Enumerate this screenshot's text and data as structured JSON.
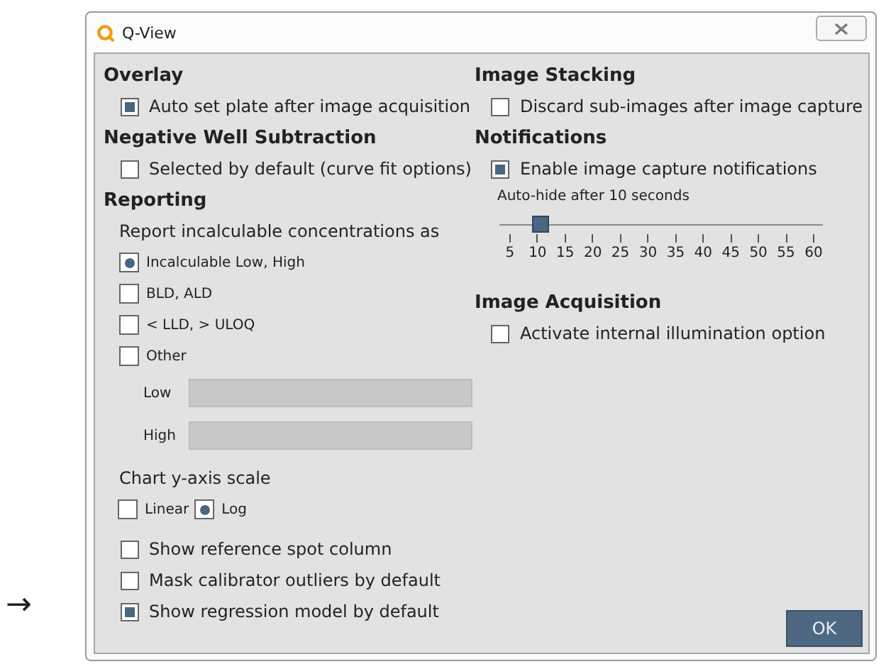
{
  "side_arrow": "→",
  "window": {
    "title": "Q-View"
  },
  "overlay": {
    "heading": "Overlay",
    "options": [
      {
        "label": "Auto set plate after image acquisition",
        "checked": true
      }
    ]
  },
  "negative_well_subtraction": {
    "heading": "Negative Well Subtraction",
    "options": [
      {
        "label": "Selected by default (curve fit options)",
        "checked": false
      }
    ]
  },
  "reporting": {
    "heading": "Reporting",
    "prompt": "Report incalculable concentrations as",
    "choices": [
      {
        "label": "Incalculable Low, High",
        "selected": true
      },
      {
        "label": "BLD, ALD",
        "selected": false
      },
      {
        "label": "< LLD, > ULOQ",
        "selected": false
      },
      {
        "label": "Other",
        "selected": false
      }
    ],
    "fields": [
      {
        "label": "Low",
        "disabled": true
      },
      {
        "label": "High",
        "disabled": true
      }
    ],
    "scale_label": "Chart y-axis scale",
    "scale_choices": [
      {
        "label": "Linear",
        "selected": false
      },
      {
        "label": "Log",
        "selected": true
      }
    ],
    "options": [
      {
        "label": "Show reference spot column",
        "checked": false
      },
      {
        "label": "Mask calibrator outliers by default",
        "checked": false
      },
      {
        "label": "Show regression model by default",
        "checked": true
      }
    ]
  },
  "image_stacking": {
    "heading": "Image Stacking",
    "options": [
      {
        "label": "Discard sub-images after image capture",
        "checked": false
      }
    ]
  },
  "notifications": {
    "heading": "Notifications",
    "options": [
      {
        "label": "Enable image capture notifications",
        "checked": true
      }
    ],
    "slider": {
      "label": "Auto-hide after 10 seconds",
      "level": 0.0909,
      "ticks": [
        "5",
        "10",
        "15",
        "20",
        "25",
        "30",
        "35",
        "40",
        "45",
        "50",
        "55",
        "60"
      ]
    }
  },
  "image_acquisition": {
    "heading": "Image Acquisition",
    "options": [
      {
        "label": "Activate internal illumination option",
        "checked": false
      }
    ]
  },
  "buttons": [
    {
      "label": "OK"
    }
  ]
}
